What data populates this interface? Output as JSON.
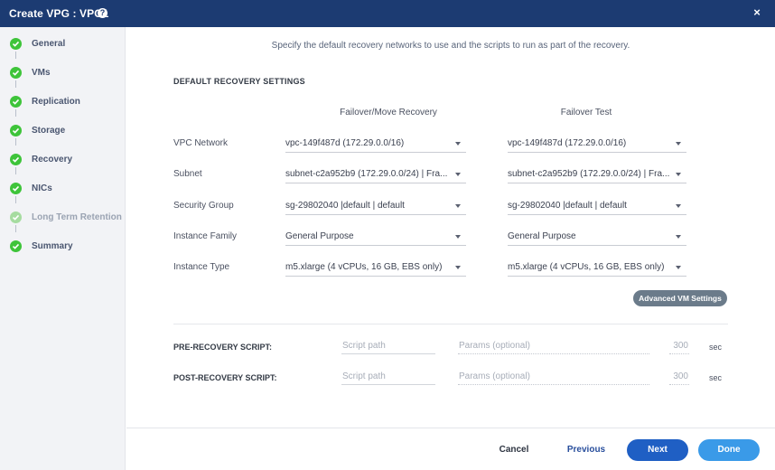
{
  "window": {
    "title": "Create VPG : VPG1",
    "help_icon": "?",
    "close_icon": "×"
  },
  "sidebar": {
    "steps": [
      {
        "label": "General",
        "state": "complete"
      },
      {
        "label": "VMs",
        "state": "complete"
      },
      {
        "label": "Replication",
        "state": "complete"
      },
      {
        "label": "Storage",
        "state": "complete"
      },
      {
        "label": "Recovery",
        "state": "current"
      },
      {
        "label": "NICs",
        "state": "complete"
      },
      {
        "label": "Long Term Retention",
        "state": "disabled"
      },
      {
        "label": "Summary",
        "state": "complete"
      }
    ]
  },
  "main": {
    "intro": "Specify the default recovery networks to use and the scripts to run as part of the recovery.",
    "section_title": "DEFAULT RECOVERY SETTINGS",
    "columns": {
      "failover": "Failover/Move Recovery",
      "test": "Failover Test"
    },
    "rows": [
      {
        "label": "VPC Network",
        "failover": "vpc-149f487d (172.29.0.0/16)",
        "test": "vpc-149f487d (172.29.0.0/16)"
      },
      {
        "label": "Subnet",
        "failover": "subnet-c2a952b9 (172.29.0.0/24) | Fra...",
        "test": "subnet-c2a952b9 (172.29.0.0/24) | Fra..."
      },
      {
        "label": "Security Group",
        "failover": "sg-29802040 |default | default",
        "test": "sg-29802040 |default | default"
      },
      {
        "label": "Instance Family",
        "failover": "General Purpose",
        "test": "General Purpose"
      },
      {
        "label": "Instance Type",
        "failover": "m5.xlarge (4 vCPUs, 16 GB, EBS only)",
        "test": "m5.xlarge (4 vCPUs, 16 GB, EBS only)"
      }
    ],
    "advanced_button": "Advanced VM Settings",
    "scripts": {
      "pre": {
        "label": "PRE-RECOVERY SCRIPT:",
        "path_placeholder": "Script path",
        "params_placeholder": "Params (optional)",
        "timeout_placeholder": "300",
        "unit": "sec"
      },
      "post": {
        "label": "POST-RECOVERY SCRIPT:",
        "path_placeholder": "Script path",
        "params_placeholder": "Params (optional)",
        "timeout_placeholder": "300",
        "unit": "sec"
      }
    }
  },
  "footer": {
    "cancel": "Cancel",
    "previous": "Previous",
    "next": "Next",
    "done": "Done"
  },
  "colors": {
    "titlebar": "#1c3b72",
    "step_complete": "#3ec43a",
    "next_button": "#1f5fc4",
    "done_button": "#3a9ae8",
    "advanced_button": "#6b7b8a"
  }
}
